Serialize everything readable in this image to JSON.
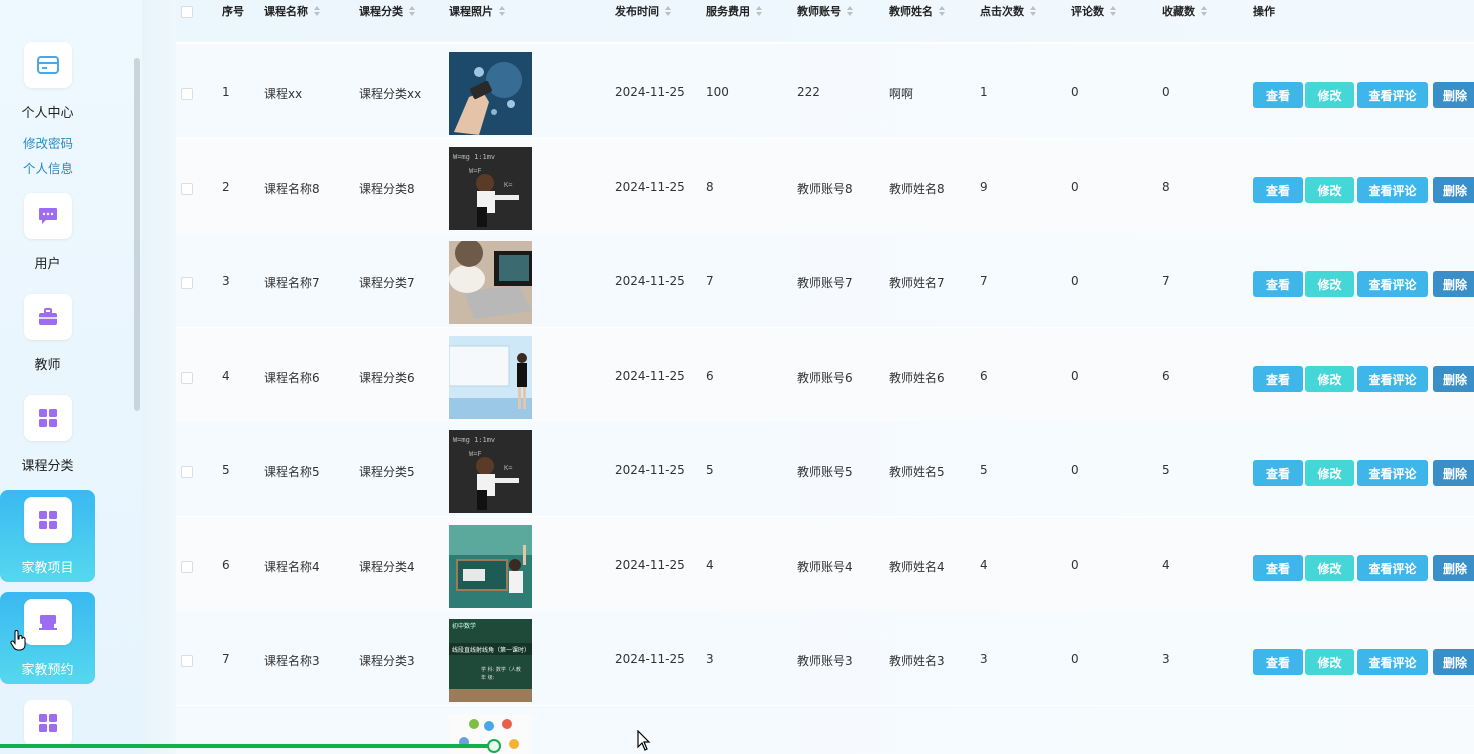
{
  "sidebar": {
    "items": [
      {
        "label": "个人中心",
        "icon": "card-icon",
        "active": false
      },
      {
        "label": "用户",
        "icon": "chat-icon",
        "active": false
      },
      {
        "label": "教师",
        "icon": "briefcase-icon",
        "active": false
      },
      {
        "label": "课程分类",
        "icon": "grid-icon",
        "active": false
      },
      {
        "label": "家教项目",
        "icon": "grid-icon",
        "active": true
      },
      {
        "label": "家教预约",
        "icon": "store-icon",
        "active": true
      }
    ],
    "submenu": [
      "修改密码",
      "个人信息"
    ]
  },
  "table": {
    "headers": [
      "序号",
      "课程名称",
      "课程分类",
      "课程照片",
      "发布时间",
      "服务费用",
      "教师账号",
      "教师姓名",
      "点击次数",
      "评论数",
      "收藏数",
      "操作"
    ],
    "actions": {
      "view": "查看",
      "edit": "修改",
      "comments": "查看评论",
      "delete": "删除"
    },
    "rows": [
      {
        "no": "1",
        "name": "课程xx",
        "category": "课程分类xx",
        "photo": "tech-hand",
        "date": "2024-11-25",
        "fee": "100",
        "account": "222",
        "teacher": "啊啊",
        "clicks": "1",
        "comments": "0",
        "favorites": "0"
      },
      {
        "no": "2",
        "name": "课程名称8",
        "category": "课程分类8",
        "photo": "chalkboard-child",
        "date": "2024-11-25",
        "fee": "8",
        "account": "教师账号8",
        "teacher": "教师姓名8",
        "clicks": "9",
        "comments": "0",
        "favorites": "8"
      },
      {
        "no": "3",
        "name": "课程名称7",
        "category": "课程分类7",
        "photo": "laptop",
        "date": "2024-11-25",
        "fee": "7",
        "account": "教师账号7",
        "teacher": "教师姓名7",
        "clicks": "7",
        "comments": "0",
        "favorites": "7"
      },
      {
        "no": "4",
        "name": "课程名称6",
        "category": "课程分类6",
        "photo": "presenter",
        "date": "2024-11-25",
        "fee": "6",
        "account": "教师账号6",
        "teacher": "教师姓名6",
        "clicks": "6",
        "comments": "0",
        "favorites": "6"
      },
      {
        "no": "5",
        "name": "课程名称5",
        "category": "课程分类5",
        "photo": "chalkboard-child",
        "date": "2024-11-25",
        "fee": "5",
        "account": "教师账号5",
        "teacher": "教师姓名5",
        "clicks": "5",
        "comments": "0",
        "favorites": "5"
      },
      {
        "no": "6",
        "name": "课程名称4",
        "category": "课程分类4",
        "photo": "green-board",
        "date": "2024-11-25",
        "fee": "4",
        "account": "教师账号4",
        "teacher": "教师姓名4",
        "clicks": "4",
        "comments": "0",
        "favorites": "4"
      },
      {
        "no": "7",
        "name": "课程名称3",
        "category": "课程分类3",
        "photo": "math-board",
        "date": "2024-11-25",
        "fee": "3",
        "account": "教师账号3",
        "teacher": "教师姓名3",
        "clicks": "3",
        "comments": "0",
        "favorites": "3"
      }
    ]
  },
  "thumb_text": {
    "math_board_title": "线段直线射线角（第一课时）",
    "math_board_top": "初中数学",
    "math_board_meta": "学 科: 数学（人教",
    "math_board_meta2": "年 级:"
  },
  "colors": {
    "accent": "#3eb6ea",
    "edit": "#45d7d8",
    "delete": "#3a8fc8",
    "progress": "#10b04c"
  }
}
